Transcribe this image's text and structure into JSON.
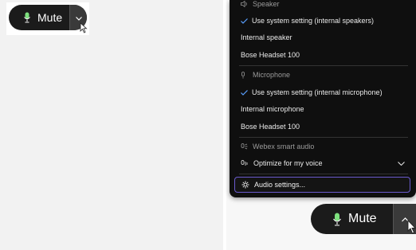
{
  "left_control": {
    "mute_label": "Mute"
  },
  "right_control": {
    "mute_label": "Mute"
  },
  "audio_menu": {
    "speaker_header": "Speaker",
    "speaker_options": [
      {
        "label": "Use system setting (internal speakers)",
        "selected": true
      },
      {
        "label": "Internal speaker",
        "selected": false
      },
      {
        "label": "Bose Headset 100",
        "selected": false
      }
    ],
    "microphone_header": "Microphone",
    "microphone_options": [
      {
        "label": "Use system setting (internal microphone)",
        "selected": true
      },
      {
        "label": "Internal microphone",
        "selected": false
      },
      {
        "label": "Bose Headset 100",
        "selected": false
      }
    ],
    "smart_audio_header": "Webex smart audio",
    "optimize_label": "Optimize for my voice",
    "settings_label": "Audio settings..."
  },
  "colors": {
    "accent_check": "#5aa0ff",
    "focus_border": "#6a5acd",
    "mic_green": "#7ee07e"
  }
}
